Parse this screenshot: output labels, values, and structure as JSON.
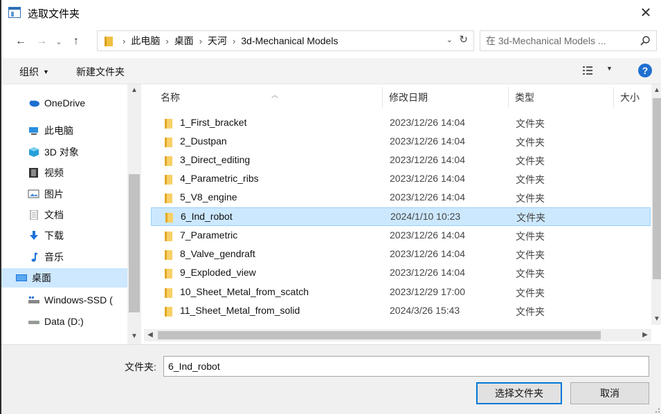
{
  "window": {
    "title": "选取文件夹",
    "close_glyph": "✕"
  },
  "nav": {
    "back_glyph": "←",
    "forward_glyph": "→",
    "recent_glyph": "⌄",
    "up_glyph": "↑"
  },
  "address": {
    "breadcrumbs": [
      "此电脑",
      "桌面",
      "天河",
      "3d-Mechanical Models"
    ],
    "separator": "›",
    "dropdown_glyph": "⌄",
    "refresh_glyph": "↻"
  },
  "search": {
    "placeholder": "在 3d-Mechanical Models ..."
  },
  "toolbar": {
    "organize_label": "组织",
    "organize_caret": "▼",
    "new_folder_label": "新建文件夹",
    "view_caret": "▼",
    "help_label": "?"
  },
  "sidebar": {
    "items": [
      {
        "label": "OneDrive",
        "icon": "cloud-icon"
      },
      {
        "label": "此电脑",
        "icon": "computer-icon"
      },
      {
        "label": "3D 对象",
        "icon": "3d-objects-icon"
      },
      {
        "label": "视频",
        "icon": "video-icon"
      },
      {
        "label": "图片",
        "icon": "pictures-icon"
      },
      {
        "label": "文档",
        "icon": "documents-icon"
      },
      {
        "label": "下载",
        "icon": "download-icon"
      },
      {
        "label": "音乐",
        "icon": "music-icon"
      },
      {
        "label": "桌面",
        "icon": "desktop-icon",
        "selected": true
      },
      {
        "label": "Windows-SSD (",
        "icon": "drive-icon"
      },
      {
        "label": "Data (D:)",
        "icon": "drive-icon"
      }
    ]
  },
  "columns": {
    "name": "名称",
    "date": "修改日期",
    "type": "类型",
    "size": "大小"
  },
  "files": [
    {
      "name": "1_First_bracket",
      "date": "2023/12/26 14:04",
      "type": "文件夹"
    },
    {
      "name": "2_Dustpan",
      "date": "2023/12/26 14:04",
      "type": "文件夹"
    },
    {
      "name": "3_Direct_editing",
      "date": "2023/12/26 14:04",
      "type": "文件夹"
    },
    {
      "name": "4_Parametric_ribs",
      "date": "2023/12/26 14:04",
      "type": "文件夹"
    },
    {
      "name": "5_V8_engine",
      "date": "2023/12/26 14:04",
      "type": "文件夹"
    },
    {
      "name": "6_Ind_robot",
      "date": "2024/1/10 10:23",
      "type": "文件夹",
      "selected": true
    },
    {
      "name": "7_Parametric",
      "date": "2023/12/26 14:04",
      "type": "文件夹"
    },
    {
      "name": "8_Valve_gendraft",
      "date": "2023/12/26 14:04",
      "type": "文件夹"
    },
    {
      "name": "9_Exploded_view",
      "date": "2023/12/26 14:04",
      "type": "文件夹"
    },
    {
      "name": "10_Sheet_Metal_from_scatch",
      "date": "2023/12/29 17:00",
      "type": "文件夹"
    },
    {
      "name": "11_Sheet_Metal_from_solid",
      "date": "2024/3/26 15:43",
      "type": "文件夹"
    }
  ],
  "footer": {
    "folder_label": "文件夹:",
    "folder_value": "6_Ind_robot",
    "select_button": "选择文件夹",
    "cancel_button": "取消"
  },
  "colors": {
    "selection": "#cce8ff",
    "accent": "#0078d7",
    "folder": "#f8d067"
  }
}
